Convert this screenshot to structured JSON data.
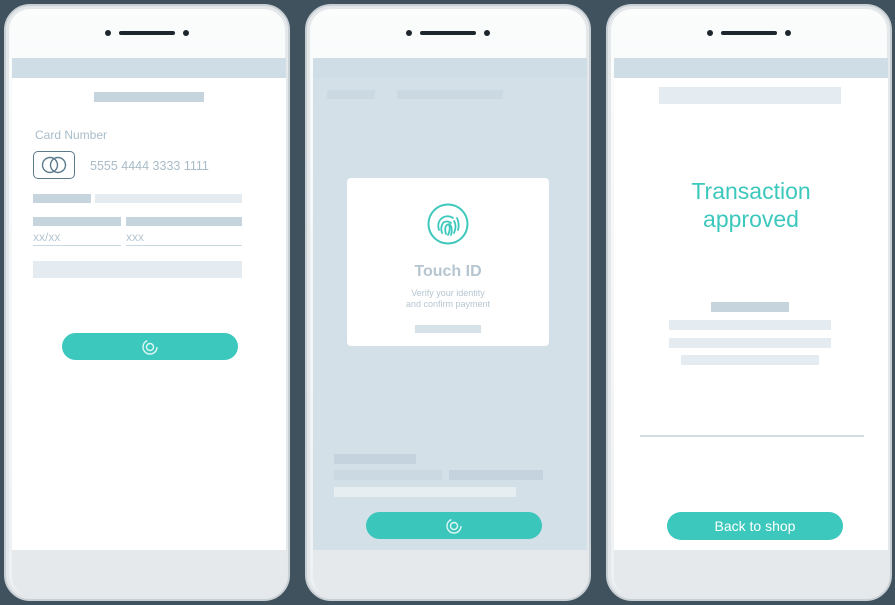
{
  "screens": {
    "payment": {
      "card_label": "Card Number",
      "card_number": "5555 4444 3333 1111",
      "expiry_placeholder": "xx/xx",
      "cvv_placeholder": "xxx",
      "submit_icon": "spinner-icon"
    },
    "touch_id": {
      "title": "Touch ID",
      "subtitle_line1": "Verify your identity",
      "subtitle_line2": "and confirm payment",
      "icon": "fingerprint-icon",
      "submit_icon": "spinner-icon"
    },
    "approved": {
      "title_line1": "Transaction",
      "title_line2": "approved",
      "button_label": "Back to shop"
    }
  },
  "colors": {
    "accent": "#3dc8bd",
    "placeholder": "#d6e1e8",
    "background": "#3f525e"
  }
}
